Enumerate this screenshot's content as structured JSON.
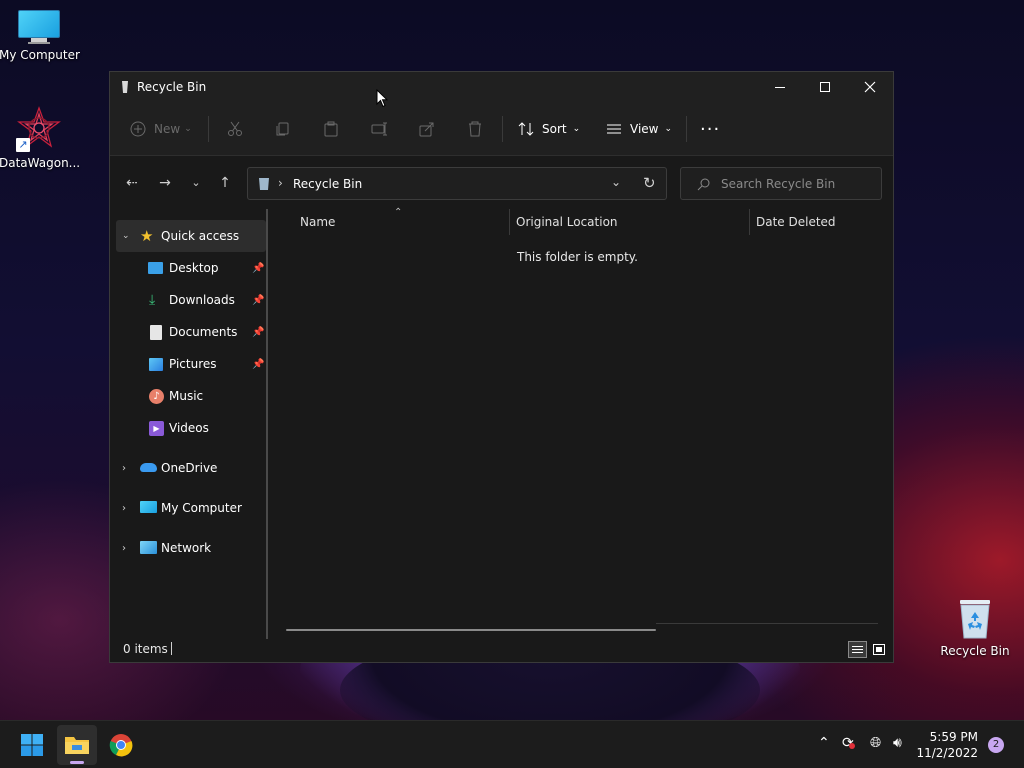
{
  "desktop": {
    "icons": [
      {
        "label": "My Computer"
      },
      {
        "label": "DataWagon..."
      },
      {
        "label": "Recycle Bin"
      }
    ]
  },
  "window": {
    "title": "Recycle Bin",
    "toolbar": {
      "new_label": "New",
      "sort_label": "Sort",
      "view_label": "View"
    },
    "address": {
      "path": "Recycle Bin",
      "search_placeholder": "Search Recycle Bin"
    },
    "sidebar": {
      "quick_access": "Quick access",
      "items": [
        {
          "label": "Desktop",
          "pinned": true
        },
        {
          "label": "Downloads",
          "pinned": true
        },
        {
          "label": "Documents",
          "pinned": true
        },
        {
          "label": "Pictures",
          "pinned": true
        },
        {
          "label": "Music",
          "pinned": false
        },
        {
          "label": "Videos",
          "pinned": false
        }
      ],
      "onedrive": "OneDrive",
      "my_computer": "My Computer",
      "network": "Network"
    },
    "columns": [
      "Name",
      "Original Location",
      "Date Deleted"
    ],
    "empty_message": "This folder is empty.",
    "status": {
      "items_count": "0 items"
    }
  },
  "taskbar": {
    "time": "5:59 PM",
    "date": "11/2/2022",
    "notifications": "2"
  }
}
